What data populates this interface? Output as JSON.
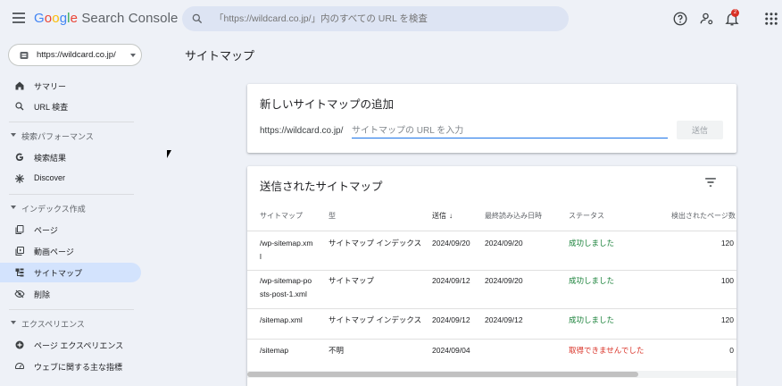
{
  "header": {
    "logo_google": [
      "G",
      "o",
      "o",
      "g",
      "l",
      "e"
    ],
    "logo_product": "Search Console",
    "search_placeholder": "「https://wildcard.co.jp/」内のすべての URL を検査",
    "notification_count": "2"
  },
  "sidebar": {
    "property": "https://wildcard.co.jp/",
    "items": [
      {
        "label": "サマリー",
        "icon": "home-icon"
      },
      {
        "label": "URL 検査",
        "icon": "search-icon"
      },
      {
        "section": "検索パフォーマンス"
      },
      {
        "label": "検索結果",
        "icon": "google-g-icon"
      },
      {
        "label": "Discover",
        "icon": "asterisk-icon"
      },
      {
        "section": "インデックス作成"
      },
      {
        "label": "ページ",
        "icon": "pages-icon"
      },
      {
        "label": "動画ページ",
        "icon": "video-icon"
      },
      {
        "label": "サイトマップ",
        "icon": "sitemap-icon",
        "active": true
      },
      {
        "label": "削除",
        "icon": "eye-off-icon"
      },
      {
        "section": "エクスペリエンス"
      },
      {
        "label": "ページ エクスペリエンス",
        "icon": "experience-icon"
      },
      {
        "label": "ウェブに関する主な指標",
        "icon": "gauge-icon"
      }
    ]
  },
  "main": {
    "page_title": "サイトマップ",
    "add_card": {
      "title": "新しいサイトマップの追加",
      "url_prefix": "https://wildcard.co.jp/",
      "input_placeholder": "サイトマップの URL を入力",
      "submit_label": "送信"
    },
    "submitted_card": {
      "title": "送信されたサイトマップ",
      "columns": [
        "サイトマップ",
        "型",
        "送信",
        "最終読み込み日時",
        "ステータス",
        "検出されたページ数"
      ],
      "sort_arrow": "↓",
      "rows": [
        {
          "sitemap": [
            "/wp-sitemap.xm",
            "l"
          ],
          "type": "サイトマップ インデックス",
          "submitted": "2024/09/20",
          "last_read": "2024/09/20",
          "status": "成功しました",
          "status_kind": "ok",
          "pages": "120"
        },
        {
          "sitemap": [
            "/wp-sitemap-po",
            "sts-post-1.xml"
          ],
          "type": "サイトマップ",
          "submitted": "2024/09/12",
          "last_read": "2024/09/20",
          "status": "成功しました",
          "status_kind": "ok",
          "pages": "100"
        },
        {
          "sitemap": [
            "/sitemap.xml"
          ],
          "type": "サイトマップ インデックス",
          "submitted": "2024/09/12",
          "last_read": "2024/09/12",
          "status": "成功しました",
          "status_kind": "ok",
          "pages": "120"
        },
        {
          "sitemap": [
            "/sitemap"
          ],
          "type": "不明",
          "submitted": "2024/09/04",
          "last_read": "",
          "status": "取得できませんでした",
          "status_kind": "err",
          "pages": "0"
        }
      ]
    }
  },
  "colors": {
    "accent": "#1a73e8",
    "active_nav": "#d3e3fd",
    "success": "#188038",
    "error": "#d93025"
  }
}
